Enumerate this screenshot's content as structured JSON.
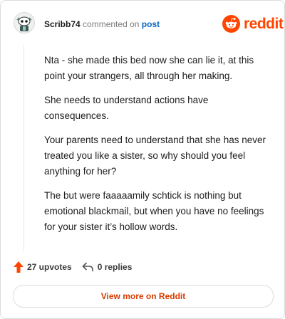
{
  "header": {
    "username": "Scribb74",
    "action_text": "commented on",
    "post_link": "post",
    "brand": "reddit"
  },
  "comment": {
    "paragraphs": [
      "Nta - she made this bed now she can lie it, at this point your strangers, all through her making.",
      "She needs to understand actions have consequences.",
      "Your parents need to understand that she has never treated you like a sister, so why should you feel anything for her?",
      "The but were faaaaamily schtick is nothing but emotional blackmail, but when you have no feelings for your sister it’s hollow words."
    ]
  },
  "actions": {
    "upvotes": "27 upvotes",
    "replies": "0 replies"
  },
  "footer": {
    "view_more": "View more on Reddit"
  },
  "colors": {
    "brand": "#ff4500",
    "upvote": "#ff4500",
    "link": "#0a66c2",
    "view_more": "#d93a00"
  },
  "icons": {
    "avatar": "snoo-avatar",
    "brand": "reddit-snoo-logo-icon",
    "upvote": "upvote-arrow-icon",
    "reply": "reply-arrow-icon"
  }
}
